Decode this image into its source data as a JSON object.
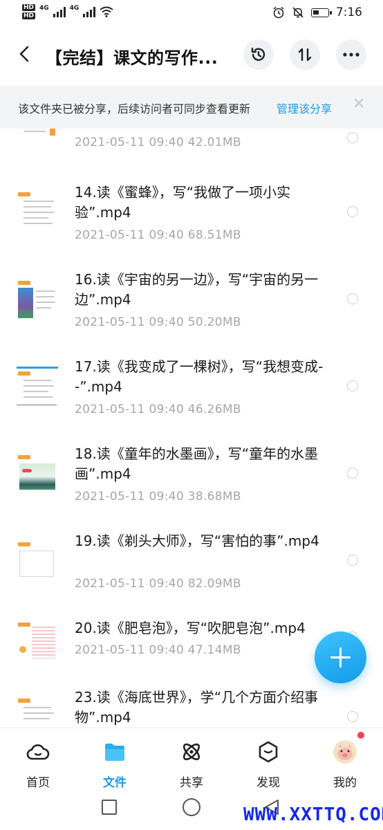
{
  "status_bar": {
    "hd1": "HD",
    "net1": "4G",
    "hd2": "HD",
    "net2": "4G",
    "time": "7:16"
  },
  "header": {
    "title": "【完结】课文的写作..."
  },
  "share_banner": {
    "text": "该文件夹已被分享，后续访问者可同步查看更新",
    "manage_link": "管理该分享",
    "close": "✕"
  },
  "files": [
    {
      "name": "",
      "date": "2021-05-11",
      "time": "09:40",
      "size": "42.01MB"
    },
    {
      "name": "14.读《蜜蜂》，写“我做了一项小实验”.mp4",
      "date": "2021-05-11",
      "time": "09:40",
      "size": "68.51MB"
    },
    {
      "name": "16.读《宇宙的另一边》，写“宇宙的另一边”.mp4",
      "date": "2021-05-11",
      "time": "09:40",
      "size": "50.20MB"
    },
    {
      "name": "17.读《我变成了一棵树》，写“我想变成--”.mp4",
      "date": "2021-05-11",
      "time": "09:40",
      "size": "46.26MB"
    },
    {
      "name": "18.读《童年的水墨画》，写“童年的水墨画”.mp4",
      "date": "2021-05-11",
      "time": "09:40",
      "size": "38.68MB"
    },
    {
      "name": "19.读《剃头大师》，写“害怕的事”.mp4",
      "date": "2021-05-11",
      "time": "09:40",
      "size": "82.09MB"
    },
    {
      "name": "20.读《肥皂泡》，写“吹肥皂泡”.mp4",
      "date": "2021-05-11",
      "time": "09:40",
      "size": "47.14MB"
    },
    {
      "name": "23.读《海底世界》，学“几个方面介绍事物”.mp4",
      "date": "",
      "time": "",
      "size": ""
    }
  ],
  "tabs": [
    {
      "label": "首页",
      "icon": "cloud-icon"
    },
    {
      "label": "文件",
      "icon": "folder-icon",
      "active": true
    },
    {
      "label": "共享",
      "icon": "atom-icon"
    },
    {
      "label": "发现",
      "icon": "discover-icon"
    },
    {
      "label": "我的",
      "icon": "avatar-icon"
    }
  ],
  "watermark": "WWW.XXTTQ.COM",
  "colors": {
    "accent": "#1c9ae6",
    "badge": "#f2435c"
  }
}
